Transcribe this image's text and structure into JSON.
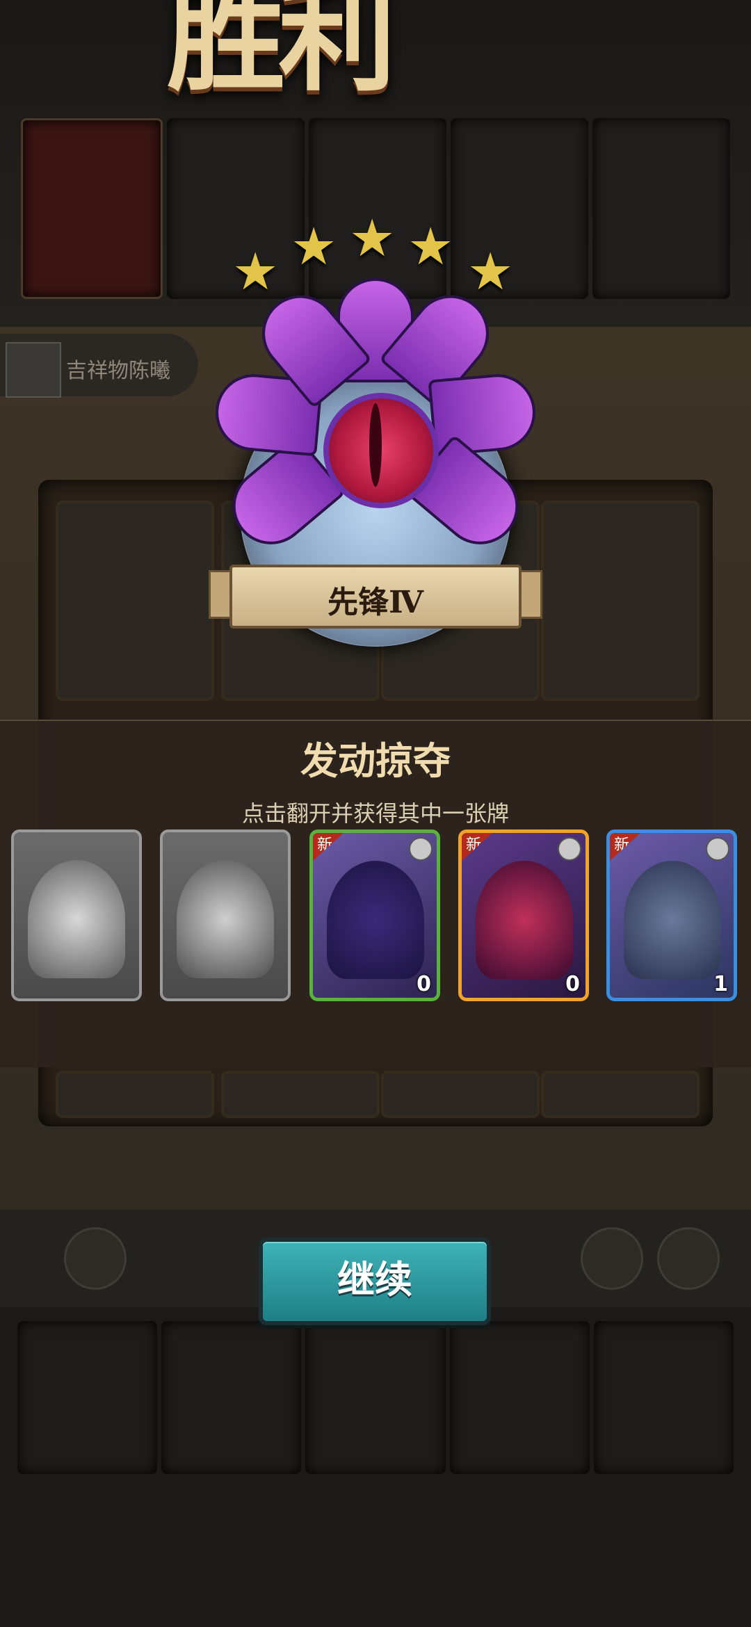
{
  "header": {
    "title": "胜利"
  },
  "player": {
    "name": "吉祥物陈曦"
  },
  "medal": {
    "rank_label": "先锋Ⅳ",
    "stars_filled": 5,
    "stars_total": 5
  },
  "raid": {
    "title": "发动掠夺",
    "subtitle": "点击翻开并获得其中一张牌",
    "cards": [
      {
        "state": "revealed-grey",
        "new_badge": "",
        "count": ""
      },
      {
        "state": "revealed-grey",
        "new_badge": "",
        "count": ""
      },
      {
        "state": "available",
        "rarity": "green",
        "new_badge": "新",
        "count": "0"
      },
      {
        "state": "available",
        "rarity": "gold",
        "new_badge": "新",
        "count": "0"
      },
      {
        "state": "available",
        "rarity": "blue",
        "new_badge": "新",
        "count": "1"
      }
    ]
  },
  "continue_button": {
    "label": "继续"
  },
  "colors": {
    "accent_button": "#2a9ca3",
    "star": "#e2c44a",
    "new_badge": "#b42a1c"
  }
}
